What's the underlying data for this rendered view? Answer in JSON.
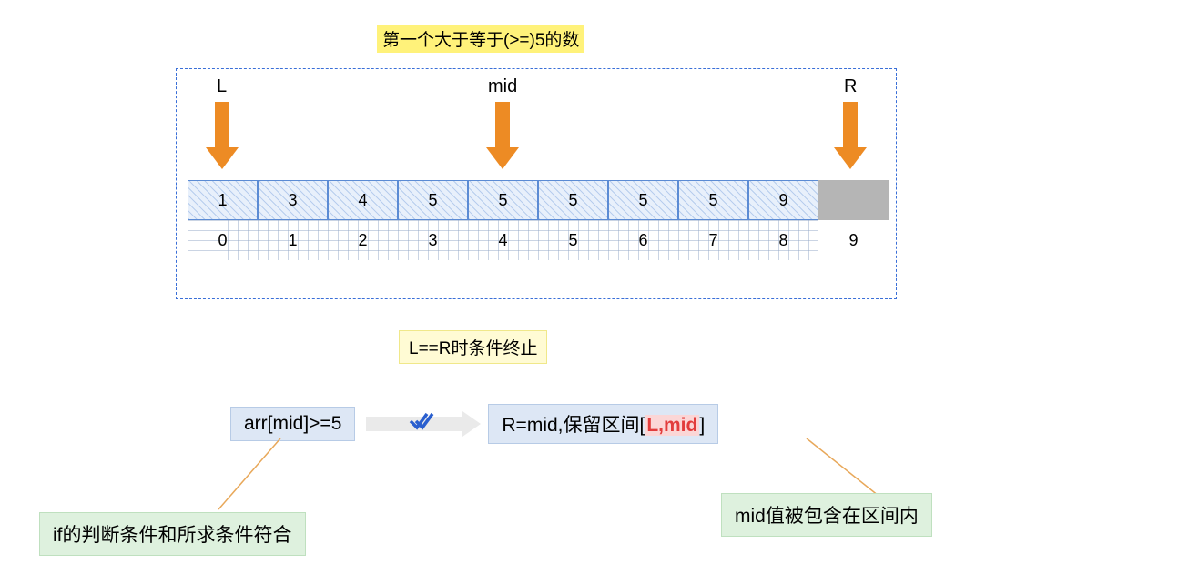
{
  "title": "第一个大于等于(>=)5的数",
  "pointers": {
    "L": {
      "label": "L",
      "index": 0
    },
    "mid": {
      "label": "mid",
      "index": 4
    },
    "R": {
      "label": "R",
      "index": 9
    }
  },
  "array_values": [
    "1",
    "3",
    "4",
    "5",
    "5",
    "5",
    "5",
    "5",
    "9"
  ],
  "indices": [
    "0",
    "1",
    "2",
    "3",
    "4",
    "5",
    "6",
    "7",
    "8",
    "9"
  ],
  "gray_cell_index": 9,
  "stop_condition": "L==R时条件终止",
  "flow": {
    "condition": "arr[mid]>=5",
    "result_prefix": "R=mid,保留区间[",
    "result_highlight": "L,mid",
    "result_suffix": "]"
  },
  "notes": {
    "left": "if的判断条件和所求条件符合",
    "right": "mid值被包含在区间内"
  }
}
